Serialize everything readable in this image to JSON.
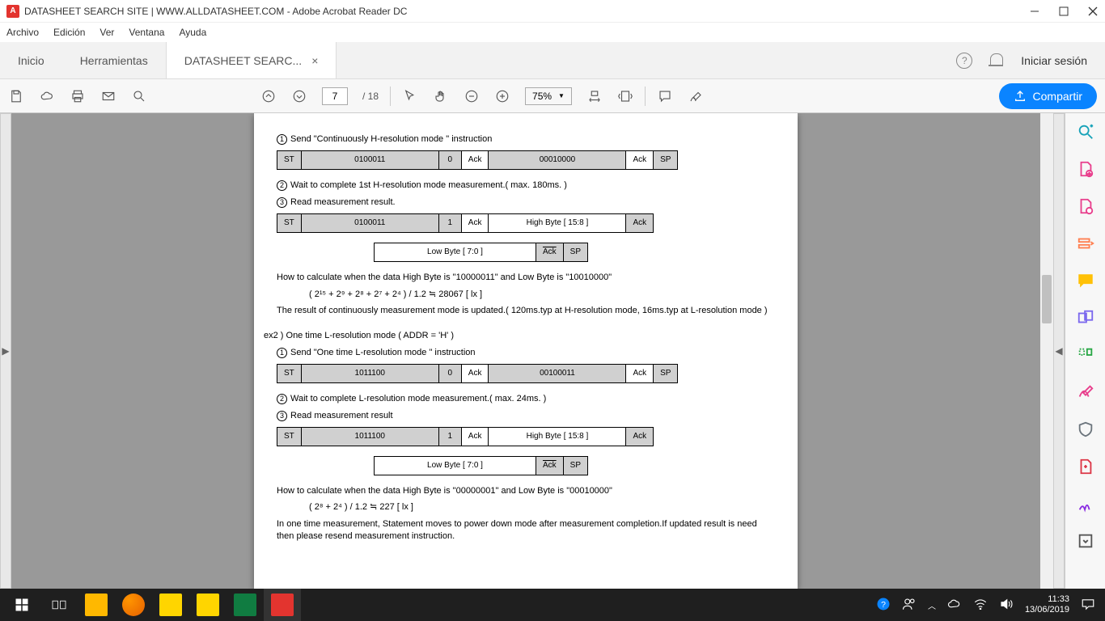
{
  "window": {
    "title": "DATASHEET SEARCH SITE | WWW.ALLDATASHEET.COM - Adobe Acrobat Reader DC",
    "app_badge": "A"
  },
  "menu": {
    "archivo": "Archivo",
    "edicion": "Edición",
    "ver": "Ver",
    "ventana": "Ventana",
    "ayuda": "Ayuda"
  },
  "tabs": {
    "inicio": "Inicio",
    "herramientas": "Herramientas",
    "doc": "DATASHEET SEARC...",
    "login": "Iniciar sesión"
  },
  "toolbar": {
    "page_current": "7",
    "page_total": "/ 18",
    "zoom": "75%",
    "share": "Compartir"
  },
  "doc": {
    "s1_title": "Send \"Continuously H-resolution mode \" instruction",
    "s2_title": "Wait to complete 1st   H-resolution mode measurement.( max. 180ms. )",
    "s3_title": "Read measurement result.",
    "t1": {
      "st": "ST",
      "addr": "0100011",
      "rw": "0",
      "ack": "Ack",
      "data": "00010000",
      "ack2": "Ack",
      "sp": "SP"
    },
    "t2": {
      "st": "ST",
      "addr": "0100011",
      "rw": "1",
      "ack": "Ack",
      "data": "High Byte [ 15:8 ]",
      "ack2": "Ack"
    },
    "t3": {
      "data": "Low Byte [ 7:0 ]",
      "ack": "Ack",
      "sp": "SP"
    },
    "calc1a": "How to calculate when the data High Byte is \"10000011\" and Low Byte is \"10010000\"",
    "calc1b": "( 2¹⁵ + 2⁹ + 2⁸ + 2⁷ + 2⁴ ) / 1.2  ≒  28067 [ lx ]",
    "note1": "The result of continuously measurement mode is updated.( 120ms.typ at H-resolution mode, 16ms.typ at L-resolution mode )",
    "ex2": "ex2 )    One time L-resolution mode ( ADDR = 'H' )",
    "s1b_title": "Send \"One time L-resolution mode \" instruction",
    "t4": {
      "st": "ST",
      "addr": "1011100",
      "rw": "0",
      "ack": "Ack",
      "data": "00100011",
      "ack2": "Ack",
      "sp": "SP"
    },
    "s2b_title": "Wait to complete L-resolution mode measurement.( max. 24ms. )",
    "s3b_title": "Read measurement result",
    "t5": {
      "st": "ST",
      "addr": "1011100",
      "rw": "1",
      "ack": "Ack",
      "data": "High Byte [ 15:8 ]",
      "ack2": "Ack"
    },
    "t6": {
      "data": "Low Byte [ 7:0 ]",
      "ack": "Ack",
      "sp": "SP"
    },
    "calc2a": "How to calculate when the data High Byte is \"00000001\" and Low Byte is \"00010000\"",
    "calc2b": "( 2⁸ + 2⁴ ) / 1.2  ≒  227 [ lx ]",
    "note2": "In one time measurement, Statement moves to power down mode after measurement completion.If updated result is need then please resend measurement instruction."
  },
  "circled": {
    "1": "1",
    "2": "2",
    "3": "3"
  },
  "over": {
    "ack_over": "Ack"
  },
  "clock": {
    "time": "11:33",
    "date": "13/06/2019"
  }
}
